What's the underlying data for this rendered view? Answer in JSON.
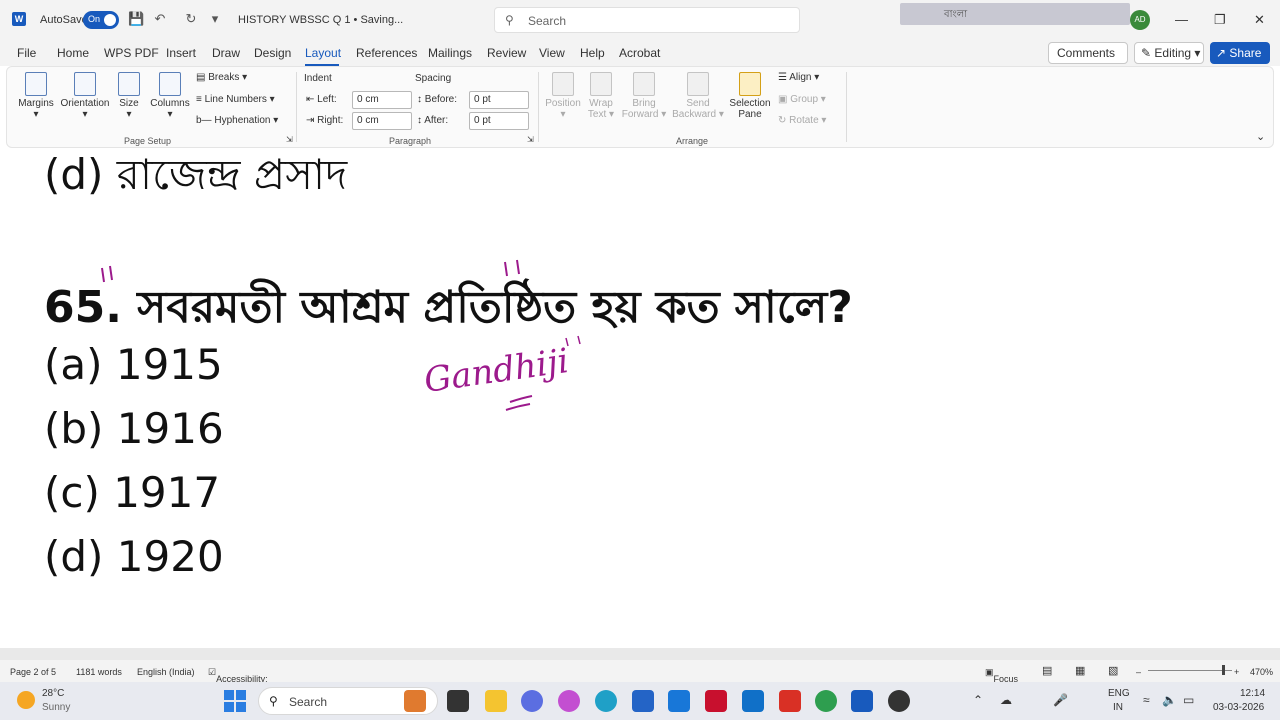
{
  "titlebar": {
    "autosave_label": "AutoSave",
    "autosave_state": "On",
    "doc_title": "HISTORY WBSSC Q 1 • Saving...",
    "search_placeholder": "Search",
    "lang_label": "বাংলা",
    "avatar_initials": "AD"
  },
  "tabs": [
    "File",
    "Home",
    "WPS PDF",
    "Insert",
    "Draw",
    "Design",
    "Layout",
    "References",
    "Mailings",
    "Review",
    "View",
    "Help",
    "Acrobat"
  ],
  "actions": {
    "comments": "Comments",
    "editing": "Editing",
    "share": "Share"
  },
  "ribbon": {
    "page_setup": {
      "margins": "Margins",
      "orientation": "Orientation",
      "size": "Size",
      "columns": "Columns",
      "breaks": "Breaks",
      "line_numbers": "Line Numbers",
      "hyphenation": "Hyphenation",
      "label": "Page Setup"
    },
    "paragraph": {
      "indent_label": "Indent",
      "spacing_label": "Spacing",
      "left_label": "Left:",
      "left_value": "0 cm",
      "right_label": "Right:",
      "right_value": "0 cm",
      "before_label": "Before:",
      "before_value": "0 pt",
      "after_label": "After:",
      "after_value": "0 pt",
      "label": "Paragraph"
    },
    "arrange": {
      "position": "Position",
      "wrap_text_1": "Wrap",
      "wrap_text_2": "Text",
      "bring_forward_1": "Bring",
      "bring_forward_2": "Forward",
      "send_backward_1": "Send",
      "send_backward_2": "Backward",
      "selection_pane_1": "Selection",
      "selection_pane_2": "Pane",
      "align": "Align",
      "group": "Group",
      "rotate": "Rotate",
      "label": "Arrange"
    }
  },
  "document": {
    "prev_option": "(d) রাজেন্দ্র প্রসাদ",
    "question": "65. সবরমতী আশ্রম প্রতিষ্ঠিত হয় কত সালে?",
    "options": [
      "(a) 1915",
      "(b) 1916",
      "(c) 1917",
      "(d) 1920"
    ],
    "ink_annotation": "Gandhiji"
  },
  "status": {
    "page": "Page 2 of 5",
    "words": "1181 words",
    "language": "English (India)",
    "accessibility": "Accessibility: Good to go",
    "focus": "Focus",
    "zoom": "470%"
  },
  "taskbar": {
    "temp": "28°C",
    "condition": "Sunny",
    "search": "Search",
    "lang_1": "ENG",
    "lang_2": "IN",
    "time": "12:14",
    "date": "03-03-2026"
  },
  "colors": {
    "accent": "#185abd",
    "ink": "#9c1a8c"
  }
}
